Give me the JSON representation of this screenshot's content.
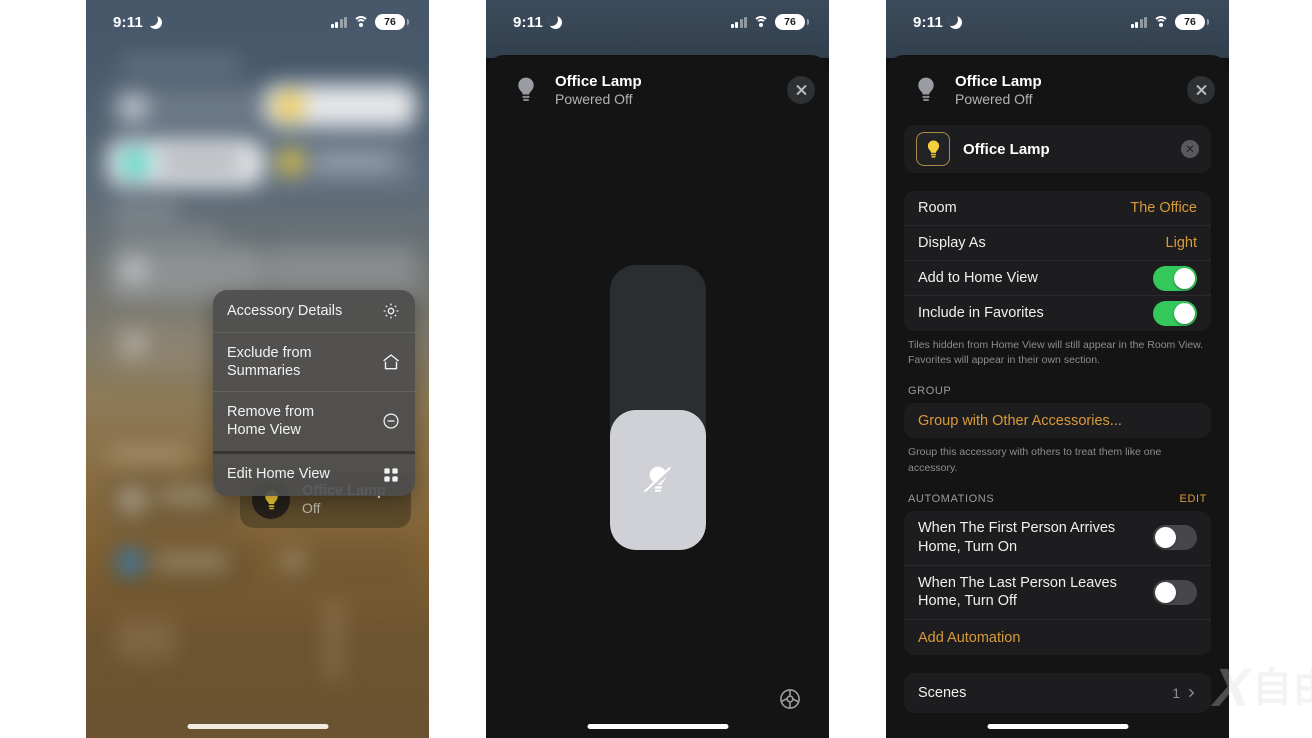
{
  "status_bar": {
    "time": "9:11",
    "moon_icon": "crescent-moon-icon",
    "signal_icon": "cellular-signal-icon",
    "wifi_icon": "wifi-icon",
    "battery_level": "76"
  },
  "panel_home": {
    "context_menu": {
      "items": [
        {
          "label": "Accessory Details",
          "icon": "gear-icon"
        },
        {
          "label": "Exclude from Summaries",
          "icon": "house-icon"
        },
        {
          "label": "Remove from\nHome View",
          "icon": "minus-circle-icon"
        },
        {
          "label": "Edit Home View",
          "icon": "grid-icon"
        }
      ]
    },
    "focused_tile": {
      "icon": "lightbulb-icon",
      "title": "Office Lamp",
      "status": "Off"
    }
  },
  "panel_control": {
    "header": {
      "icon": "lightbulb-icon",
      "title": "Office Lamp",
      "subtitle": "Powered Off",
      "close_icon": "close-icon"
    },
    "brightness_slider": {
      "icon": "lightbulb-slash-icon",
      "fill_percent": 49
    },
    "settings_button_icon": "gear-icon"
  },
  "panel_settings": {
    "header": {
      "icon": "lightbulb-icon",
      "title": "Office Lamp",
      "subtitle": "Powered Off",
      "close_icon": "close-icon"
    },
    "name_field": {
      "icon": "lightbulb-icon",
      "value": "Office Lamp",
      "clear_icon": "clear-field-icon"
    },
    "main_rows": [
      {
        "label": "Room",
        "value": "The Office",
        "type": "value"
      },
      {
        "label": "Display As",
        "value": "Light",
        "type": "value"
      },
      {
        "label": "Add to Home View",
        "toggle": "on",
        "type": "toggle"
      },
      {
        "label": "Include in Favorites",
        "toggle": "on",
        "type": "toggle"
      }
    ],
    "main_footnote": "Tiles hidden from Home View will still appear in the Room View. Favorites will appear in their own section.",
    "group_section": {
      "header": "GROUP",
      "action": "Group with Other Accessories...",
      "footnote": "Group this accessory with others to treat them like one accessory."
    },
    "automations_section": {
      "header": "AUTOMATIONS",
      "edit": "EDIT",
      "rows": [
        {
          "label": "When The First Person Arrives Home, Turn On",
          "toggle": "off"
        },
        {
          "label": "When The Last Person Leaves Home, Turn Off",
          "toggle": "off"
        }
      ],
      "add_action": "Add Automation"
    },
    "scenes_row": {
      "label": "Scenes",
      "count": "1",
      "chevron": "chevron-right-icon"
    }
  },
  "watermark": {
    "mark": "X",
    "text": "自由"
  },
  "colors": {
    "accent_orange": "#d99a3a",
    "toggle_on_green": "#34c759",
    "bulb_yellow": "#f5cf3d"
  }
}
